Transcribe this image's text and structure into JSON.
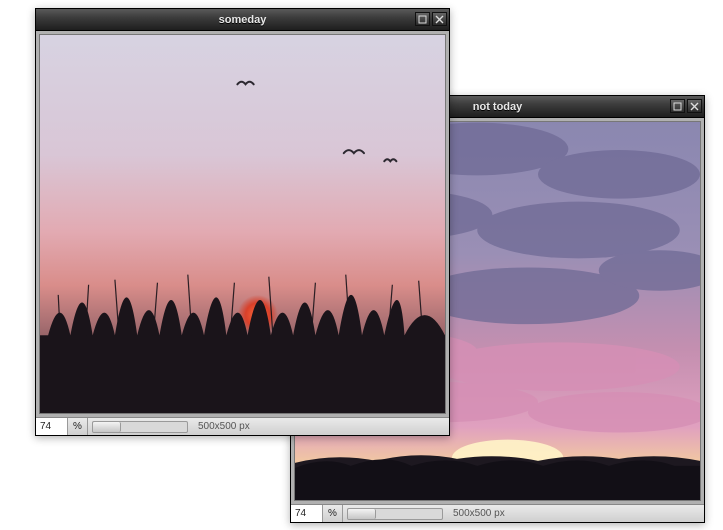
{
  "windows": [
    {
      "id": "a",
      "title": "someday",
      "zoom": "74",
      "pct_label": "%",
      "dimensions": "500x500 px"
    },
    {
      "id": "b",
      "title": "not today",
      "zoom": "74",
      "pct_label": "%",
      "dimensions": "500x500 px"
    }
  ]
}
